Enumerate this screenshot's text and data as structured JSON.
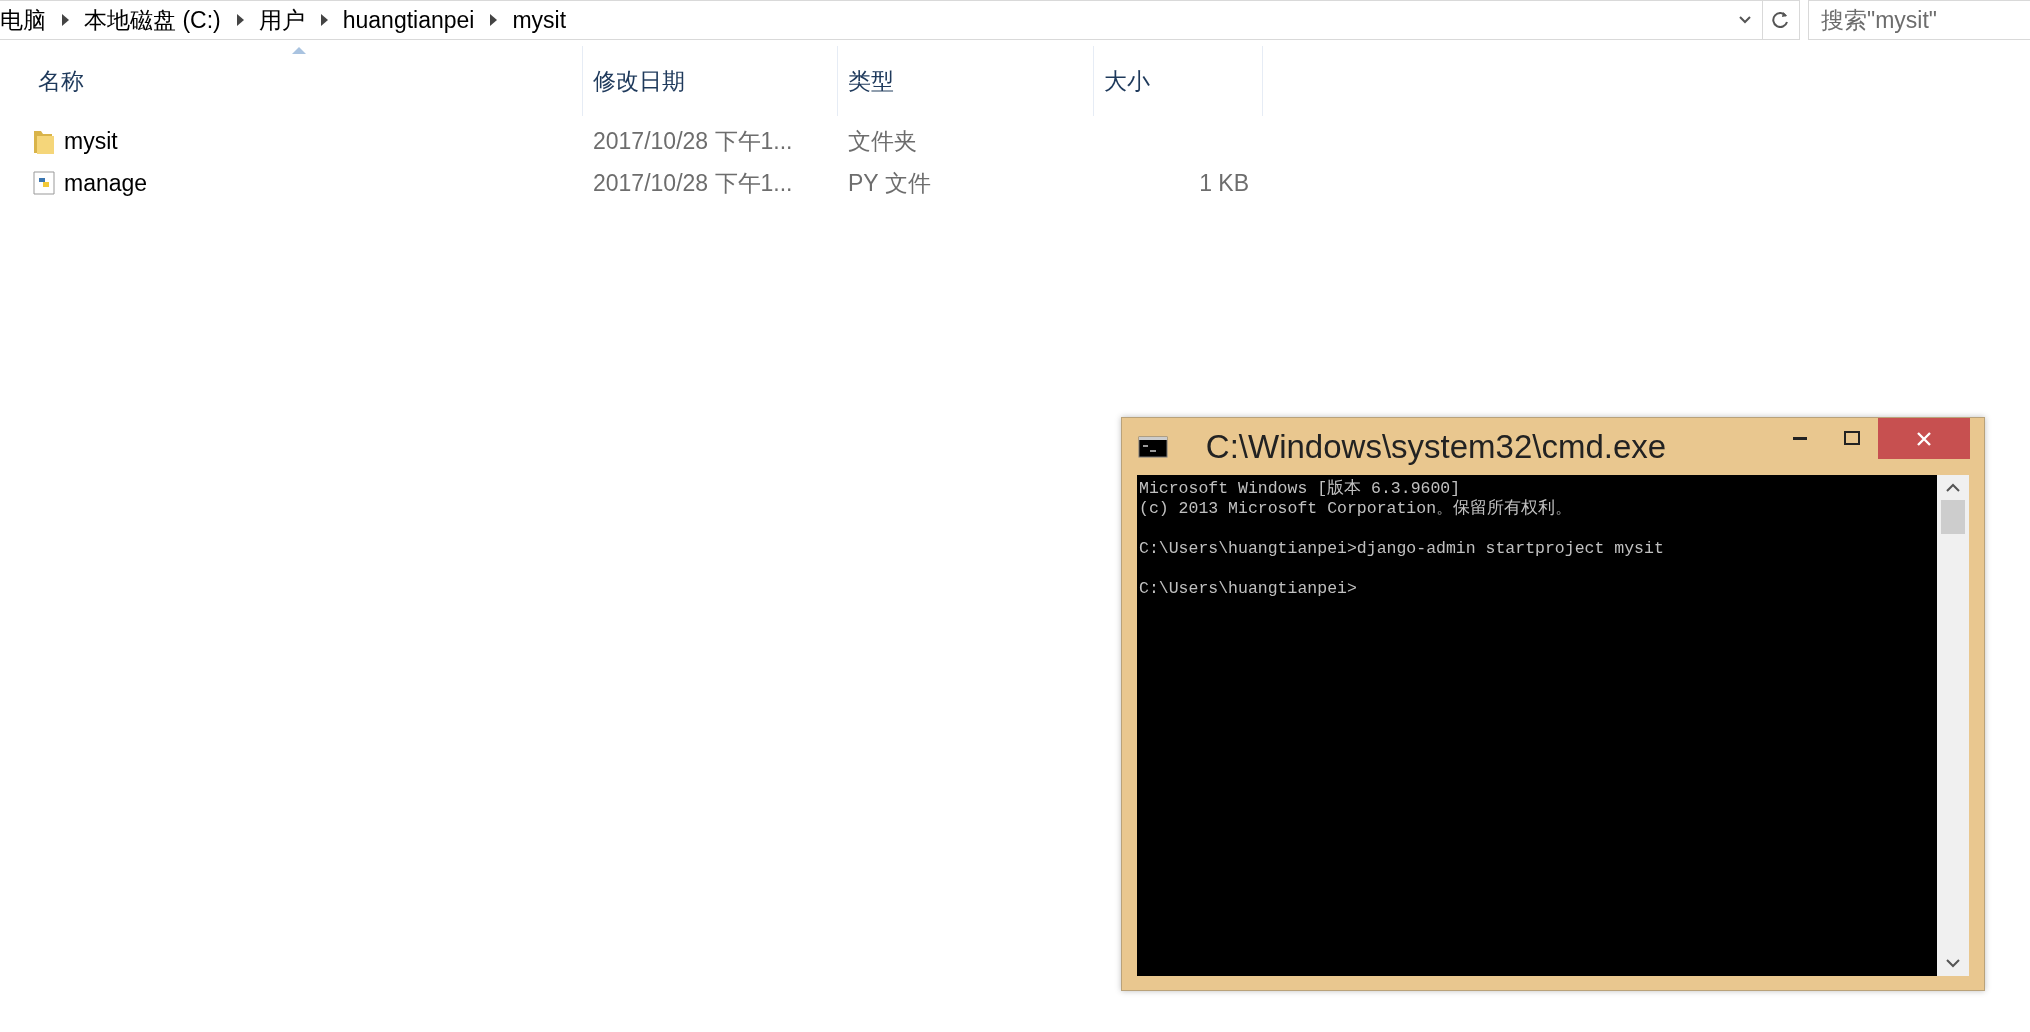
{
  "address_bar": {
    "breadcrumbs": [
      "电脑",
      "本地磁盘 (C:)",
      "用户",
      "huangtianpei",
      "mysit"
    ],
    "search": {
      "placeholder": "搜索\"mysit\""
    }
  },
  "file_list": {
    "columns": [
      {
        "label": "名称",
        "sorted": true
      },
      {
        "label": "修改日期",
        "sorted": false
      },
      {
        "label": "类型",
        "sorted": false
      },
      {
        "label": "大小",
        "sorted": false
      }
    ],
    "rows": [
      {
        "kind": "folder",
        "name": "mysit",
        "modified": "2017/10/28 下午1...",
        "type": "文件夹"
      },
      {
        "kind": "python",
        "name": "manage",
        "modified": "2017/10/28 下午1...",
        "type": "PY 文件",
        "size": "1 KB"
      }
    ]
  },
  "cmd_window": {
    "title": "C:\\Windows\\system32\\cmd.exe",
    "lines": [
      {
        "text": "Microsoft Windows [版本 6.3.9600]",
        "blank_before": false
      },
      {
        "text": "(c) 2013 Microsoft Corporation。保留所有权利。",
        "blank_before": false
      },
      {
        "text": "C:\\Users\\huangtianpei>django-admin startproject mysit",
        "blank_before": true
      },
      {
        "text": "C:\\Users\\huangtianpei>",
        "blank_before": true
      }
    ]
  }
}
